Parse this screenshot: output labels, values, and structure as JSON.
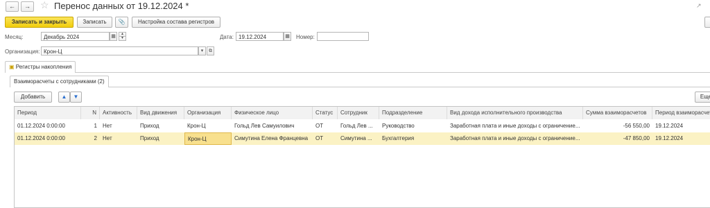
{
  "nav": {
    "back": "←",
    "forward": "→",
    "star": "☆",
    "link": "🔗"
  },
  "title": "Перенос данных  от 19.12.2024 *",
  "toolbar": {
    "save_close": "Записать и закрыть",
    "save": "Записать",
    "settings": "Настройка состава регистров"
  },
  "form": {
    "month_label": "Месяц:",
    "month_value": "Декабрь 2024",
    "date_label": "Дата:",
    "date_value": "19.12.2024",
    "number_label": "Номер:",
    "number_value": "",
    "org_label": "Организация:",
    "org_value": "Крон-Ц"
  },
  "tabs": {
    "outer": "Регистры накопления",
    "inner": "Взаиморасчеты с сотрудниками (2)"
  },
  "grid_toolbar": {
    "add": "Добавить",
    "more": "Еще"
  },
  "table": {
    "columns": [
      "Период",
      "N",
      "Активность",
      "Вид движения",
      "Организация",
      "Физическое лицо",
      "Статус",
      "Сотрудник",
      "Подразделение",
      "Вид дохода исполнительного производства",
      "Сумма взаиморасчетов",
      "Период взаиморасчетов"
    ],
    "rows": [
      [
        "01.12.2024 0:00:00",
        "1",
        "Нет",
        "Приход",
        "Крон-Ц",
        "Гольд Лев Самуилович",
        "ОТ",
        "Гольд Лев ...",
        "Руководство",
        "Заработная плата и иные доходы с ограничение...",
        "-56 550,00",
        "19.12.2024"
      ],
      [
        "01.12.2024 0:00:00",
        "2",
        "Нет",
        "Приход",
        "Крон-Ц",
        "Симутина Елена Францевна",
        "ОТ",
        "Симутина ...",
        "Бухгалтерия",
        "Заработная плата и иные доходы с ограничение...",
        "-47 850,00",
        "19.12.2024"
      ]
    ],
    "selected_row": 1,
    "selection_color": "#fbf2c4",
    "active_cell_color": "#f8e08e"
  }
}
